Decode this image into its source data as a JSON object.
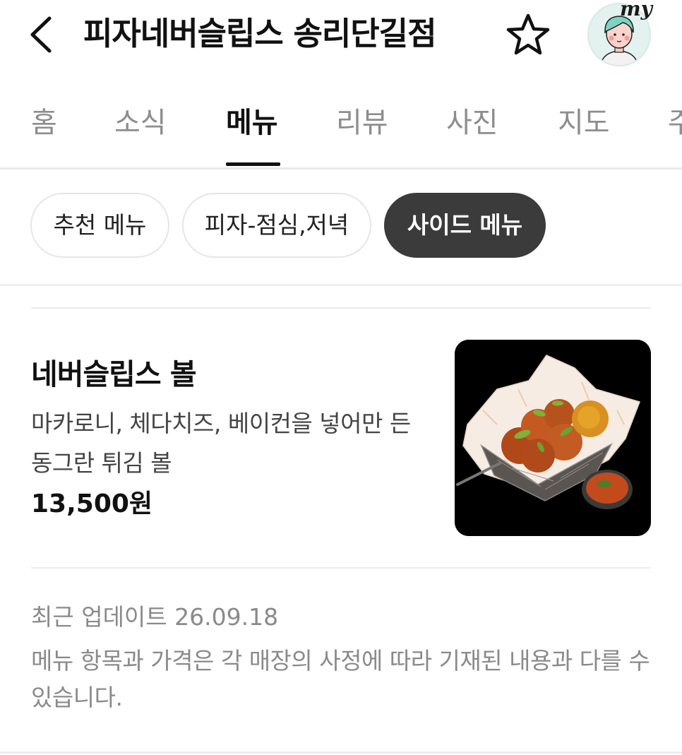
{
  "header": {
    "back_icon": "chevron-left-icon",
    "title": "피자네버슬립스 송리단길점",
    "favorite_icon": "star-outline-icon",
    "profile_badge": "my"
  },
  "tabs": [
    {
      "label": "홈",
      "active": false
    },
    {
      "label": "소식",
      "active": false
    },
    {
      "label": "메뉴",
      "active": true
    },
    {
      "label": "리뷰",
      "active": false
    },
    {
      "label": "사진",
      "active": false
    },
    {
      "label": "지도",
      "active": false
    },
    {
      "label": "주",
      "active": false
    }
  ],
  "categories": [
    {
      "label": "추천 메뉴",
      "active": false
    },
    {
      "label": "피자-점심,저녁",
      "active": false
    },
    {
      "label": "사이드 메뉴",
      "active": true
    }
  ],
  "menu_item": {
    "name": "네버슬립스 볼",
    "description": "마카로니, 체다치즈, 베이컨을 넣어만 든 동그란 튀김 볼",
    "price": "13,500원"
  },
  "footer": {
    "updated": "최근 업데이트 26.09.18",
    "notice": "메뉴 항목과 가격은 각 매장의 사정에 따라 기재된 내용과 다를 수 있습니다."
  },
  "colors": {
    "active_chip_bg": "#3b3b3b",
    "inactive_text": "#8d8d8d",
    "avatar_bg": "#e3f2ef"
  }
}
